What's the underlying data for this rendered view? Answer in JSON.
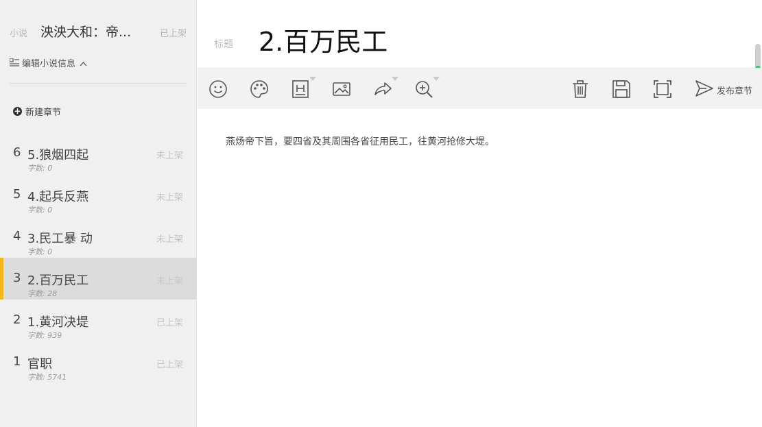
{
  "sidebar": {
    "novel_tag": "小说",
    "novel_title": "泱泱大和：帝...",
    "novel_status": "已上架",
    "edit_info": "编辑小说信息",
    "new_chapter": "新建章节",
    "chapters": [
      {
        "num": "6",
        "title": "5.狼烟四起",
        "count": "字数: 0",
        "status": "未上架",
        "active": false
      },
      {
        "num": "5",
        "title": "4.起兵反燕",
        "count": "字数: 0",
        "status": "未上架",
        "active": false
      },
      {
        "num": "4",
        "title": "3.民工暴 动",
        "count": "字数: 0",
        "status": "未上架",
        "active": false
      },
      {
        "num": "3",
        "title": "2.百万民工",
        "count": "字数: 28",
        "status": "未上架",
        "active": true
      },
      {
        "num": "2",
        "title": "1.黄河决堤",
        "count": "字数: 939",
        "status": "已上架",
        "active": false
      },
      {
        "num": "1",
        "title": "官职",
        "count": "字数: 5741",
        "status": "已上架",
        "active": false
      }
    ]
  },
  "editor": {
    "title_tag": "标题",
    "title": "2.百万民工",
    "content": "燕炀帝下旨，要四省及其周围各省征用民工，往黄河抢修大堤。"
  },
  "toolbar": {
    "icons": [
      "emoji-icon",
      "palette-icon",
      "heading-icon",
      "image-icon",
      "share-icon",
      "zoom-in-icon",
      "trash-icon",
      "save-icon",
      "fullscreen-icon"
    ],
    "publish_label": "发布章节"
  },
  "colors": {
    "active_accent": "#f6b81a",
    "scroll_green": "#34c46a",
    "sidebar_bg": "#f0f0f0",
    "toolbar_bg": "#f2f2f2"
  }
}
